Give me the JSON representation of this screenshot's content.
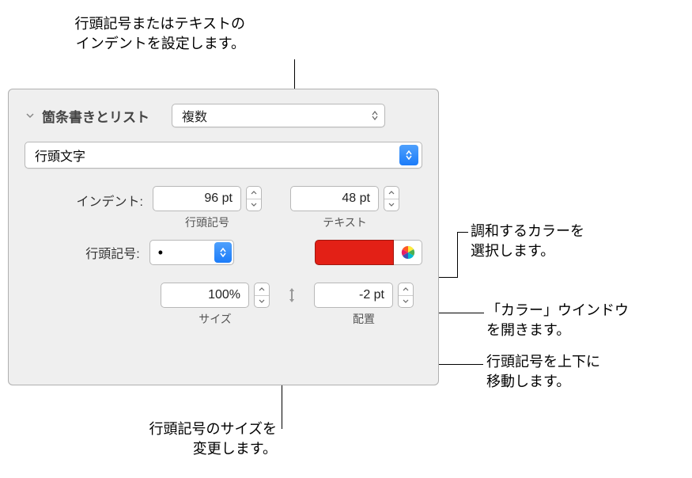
{
  "callouts": {
    "indent": "行頭記号またはテキストの\nインデントを設定します。",
    "matchColor": "調和するカラーを\n選択します。",
    "colorWindow": "「カラー」ウインドウ\nを開きます。",
    "moveBullet": "行頭記号を上下に\n移動します。",
    "changeSize": "行頭記号のサイズを\n変更します。"
  },
  "panel": {
    "sectionTitle": "箇条書きとリスト",
    "styleSelect": "複数",
    "bulletTypeSelect": "行頭文字",
    "indentLabel": "インデント:",
    "bulletIndentValue": "96 pt",
    "textIndentValue": "48 pt",
    "bulletIndentSublabel": "行頭記号",
    "textIndentSublabel": "テキスト",
    "bulletSymbolLabel": "行頭記号:",
    "bulletSymbolValue": "•",
    "sizeValue": "100%",
    "sizeSublabel": "サイズ",
    "alignValue": "-2 pt",
    "alignSublabel": "配置",
    "swatchColor": "#e32016"
  }
}
